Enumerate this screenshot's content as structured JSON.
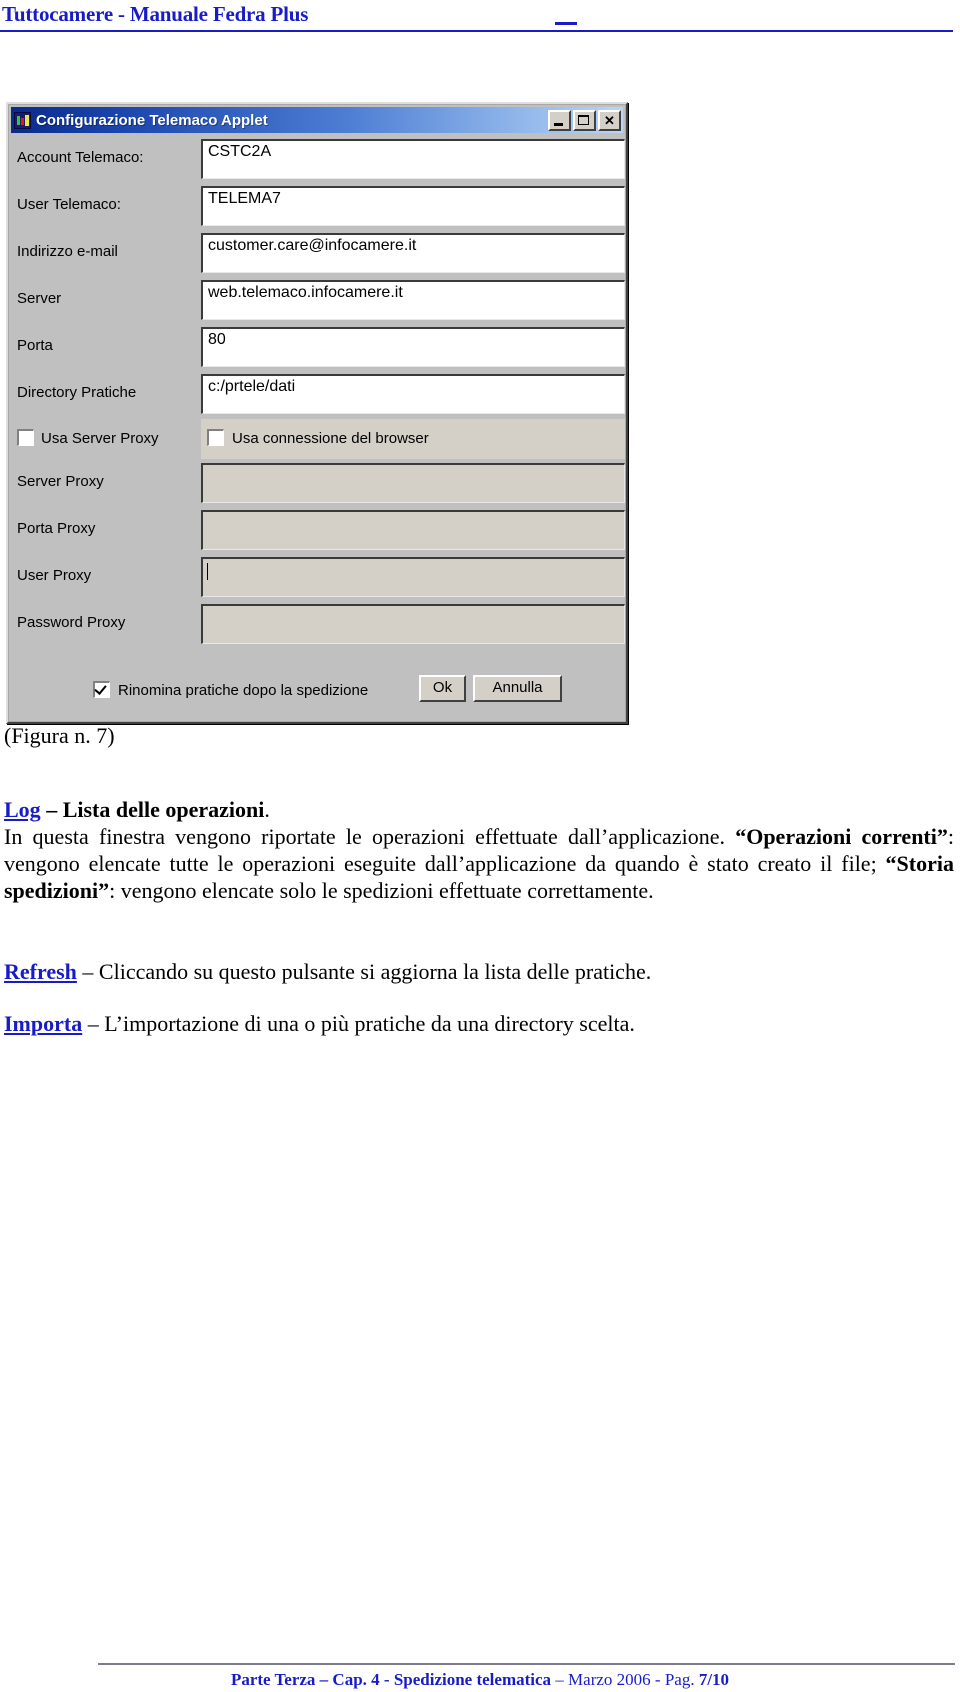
{
  "header": {
    "title": "Tuttocamere - Manuale Fedra Plus"
  },
  "dialog": {
    "title": "Configurazione Telemaco Applet",
    "icon": "application-icon",
    "window_buttons": {
      "minimize": "_",
      "maximize": "□",
      "close": "✕"
    },
    "fields": [
      {
        "label": "Account Telemaco:",
        "value": "CSTC2A",
        "disabled": false
      },
      {
        "label": "User Telemaco:",
        "value": "TELEMA7",
        "disabled": false
      },
      {
        "label": "Indirizzo e-mail",
        "value": "customer.care@infocamere.it",
        "disabled": false
      },
      {
        "label": "Server",
        "value": "web.telemaco.infocamere.it",
        "disabled": false
      },
      {
        "label": "Porta",
        "value": "80",
        "disabled": false
      },
      {
        "label": "Directory Pratiche",
        "value": "c:/prtele/dati",
        "disabled": false
      }
    ],
    "proxy_checkbox": {
      "label": "Usa Server Proxy",
      "checked": false
    },
    "browser_checkbox": {
      "label": "Usa connessione del browser",
      "checked": false
    },
    "proxy_fields": [
      {
        "label": "Server Proxy",
        "value": "",
        "disabled": true
      },
      {
        "label": "Porta Proxy",
        "value": "",
        "disabled": true
      },
      {
        "label": "User Proxy",
        "value": "",
        "disabled": true
      },
      {
        "label": "Password Proxy",
        "value": "",
        "disabled": true
      }
    ],
    "rename_checkbox": {
      "label": "Rinomina pratiche dopo la spedizione",
      "checked": true
    },
    "ok_button": "Ok",
    "cancel_button": "Annulla"
  },
  "document": {
    "figure_caption": "(Figura n. 7)",
    "sections": [
      {
        "term": "Log",
        "dash": " – ",
        "heading": "Lista delle operazioni",
        "heading_suffix": ".",
        "body_1": "In questa finestra vengono riportate le operazioni effettuate dall’applicazione. ",
        "bold_1": "“Operazioni correnti”",
        "body_2": ": vengono elencate tutte le operazioni eseguite dall’applicazione da quando è stato creato il file; ",
        "bold_2": "“Storia spedizioni”",
        "body_3": ": vengono elencate solo le spedizioni effettuate correttamente."
      },
      {
        "term": "Refresh",
        "dash": " – ",
        "body": "Cliccando su questo pulsante si aggiorna la lista delle pratiche."
      },
      {
        "term": "Importa",
        "dash": " – ",
        "body": "L’importazione di una o più pratiche da una directory scelta."
      }
    ]
  },
  "footer": {
    "part": "Parte Terza – Cap. 4 - Spedizione telematica",
    "separator": " – ",
    "date": "Marzo 2006 - Pag. ",
    "page": "7/10"
  },
  "colors": {
    "link": "#181CC8",
    "titlebar_start": "#0A2A8C",
    "titlebar_end": "#BCD6F5",
    "dialog_face": "#C0C0C0",
    "field_disabled": "#D4D0C8"
  }
}
